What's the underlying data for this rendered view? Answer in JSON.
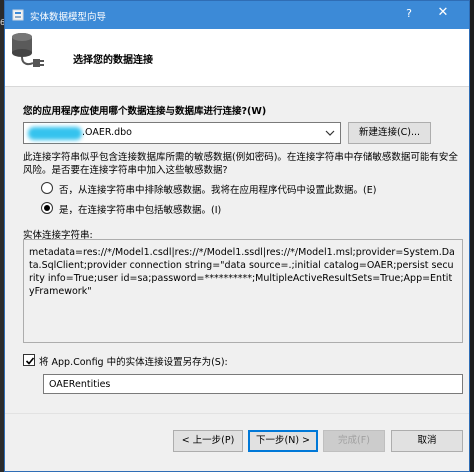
{
  "edge": {
    "glyph": "6"
  },
  "window": {
    "title": "实体数据模型向导",
    "help": "?",
    "close": "✕"
  },
  "header": {
    "step_title": "选择您的数据连接"
  },
  "connection": {
    "question": "您的应用程序应使用哪个数据连接与数据库进行连接?(W)",
    "selected_value": ".OAER.dbo",
    "new_connection_label": "新建连接(C)..."
  },
  "sensitive": {
    "warning": "此连接字符串似乎包含连接数据库所需的敏感数据(例如密码)。在连接字符串中存储敏感数据可能有安全风险。是否要在连接字符串中加入这些敏感数据?",
    "option_no": "否，从连接字符串中排除敏感数据。我将在应用程序代码中设置此数据。(E)",
    "option_yes": "是，在连接字符串中包括敏感数据。(I)"
  },
  "entity_connection": {
    "label": "实体连接字符串:",
    "value": "metadata=res://*/Model1.csdl|res://*/Model1.ssdl|res://*/Model1.msl;provider=System.Data.SqlClient;provider connection string=\"data source=.;initial catalog=OAER;persist security info=True;user id=sa;password=**********;MultipleActiveResultSets=True;App=EntityFramework\""
  },
  "save_config": {
    "checked": true,
    "label": "将 App.Config 中的实体连接设置另存为(S):",
    "value": "OAERentities"
  },
  "footer": {
    "prev": "< 上一步(P)",
    "next": "下一步(N) >",
    "finish": "完成(F)",
    "cancel": "取消"
  },
  "colors": {
    "titlebar": "#3c8ad7",
    "dialog_bg": "#f0f0f0",
    "accent": "#0078d7"
  }
}
